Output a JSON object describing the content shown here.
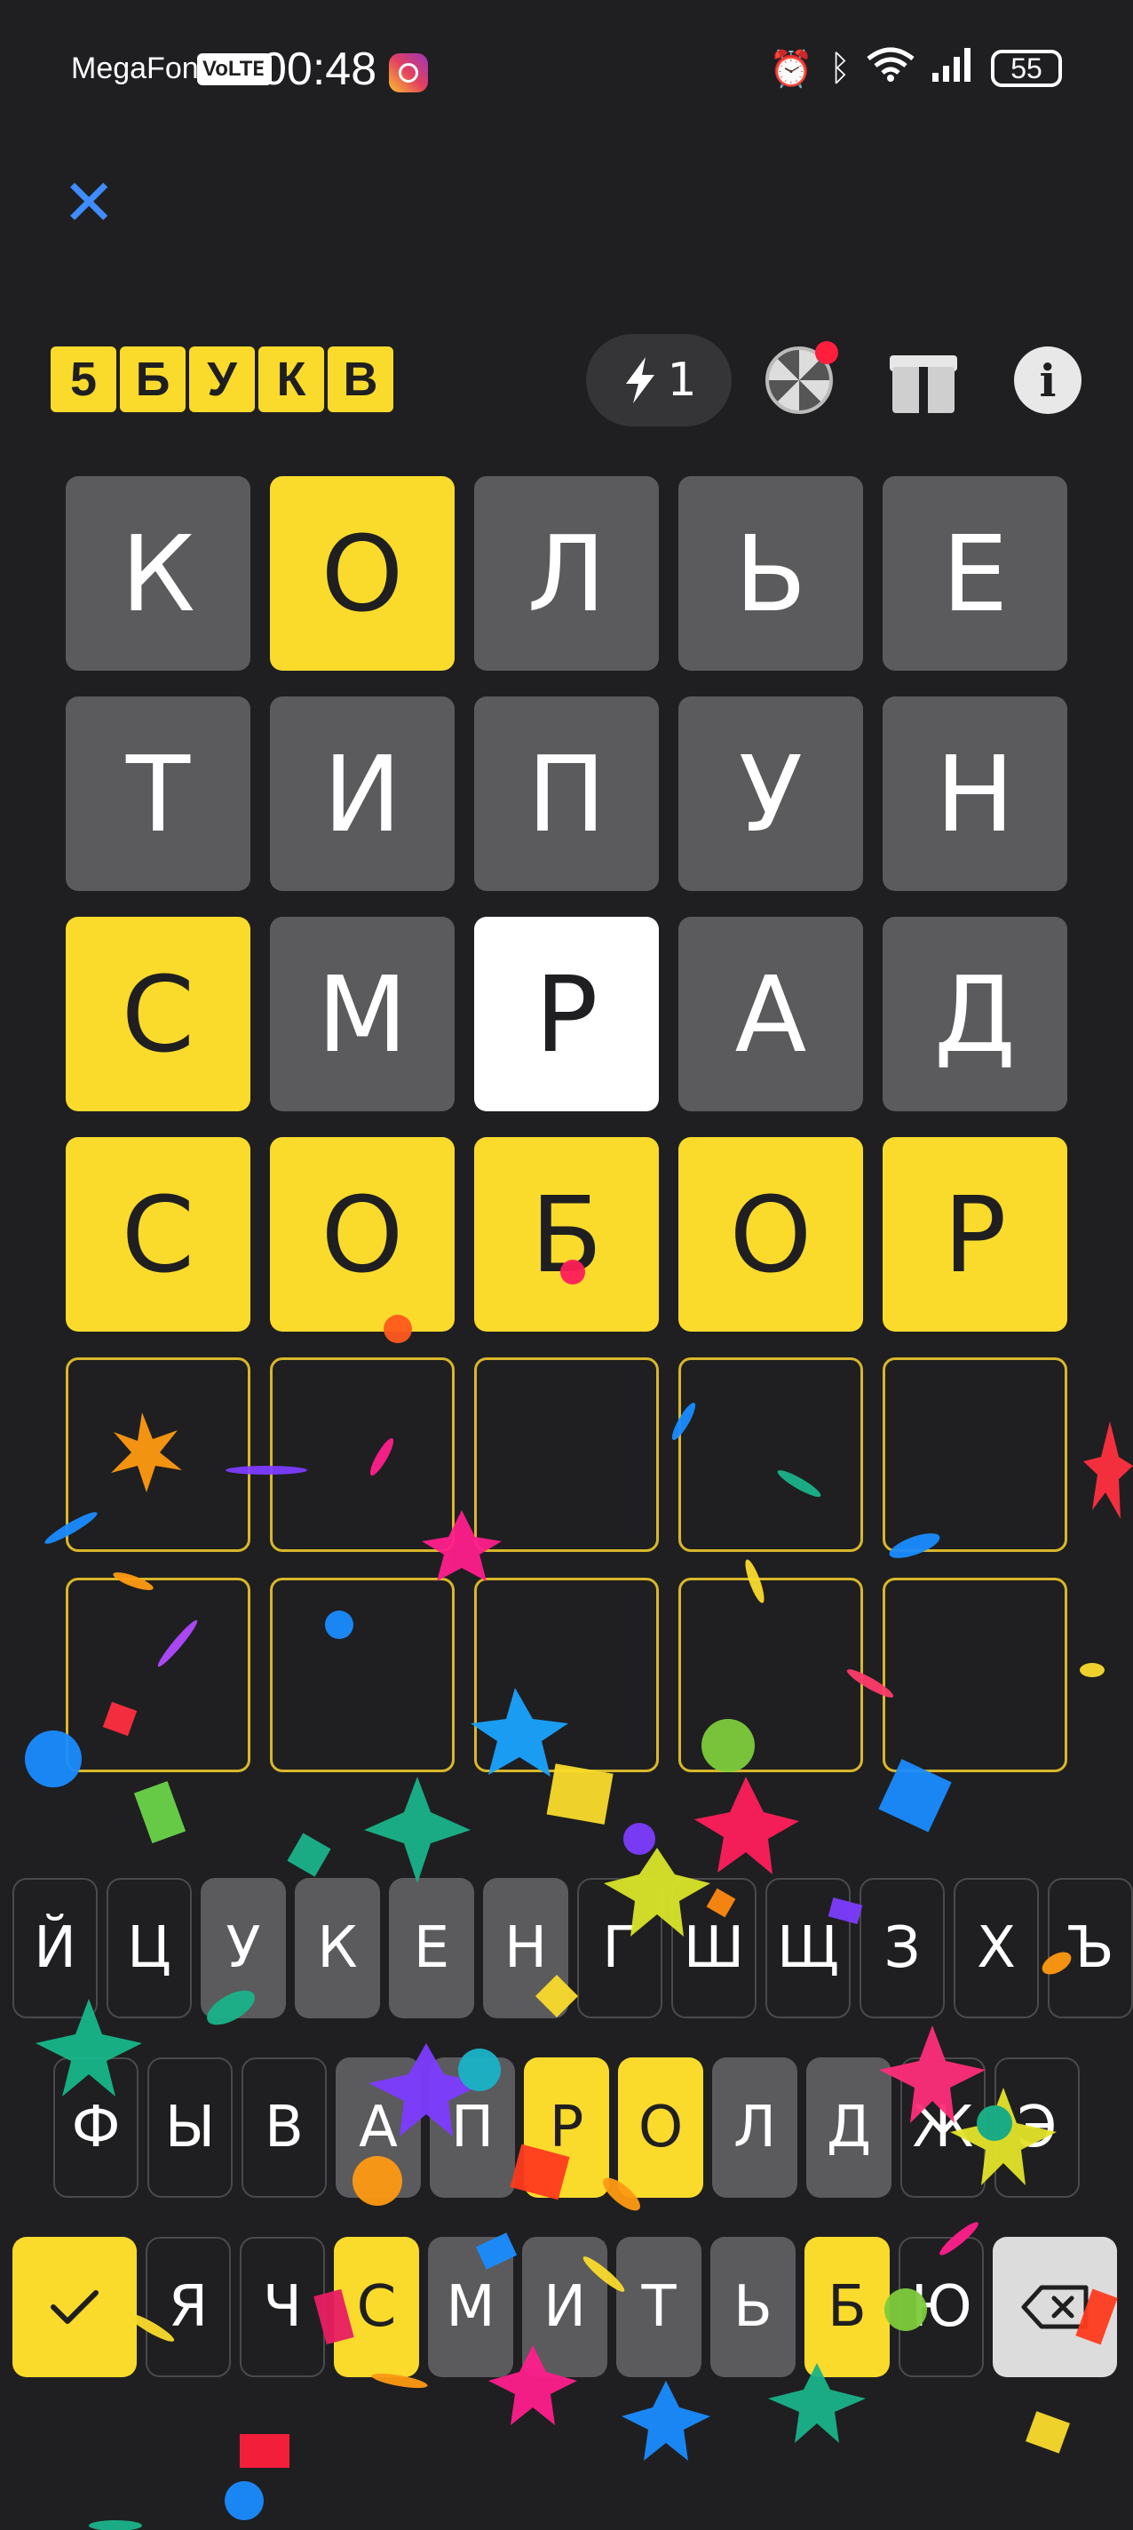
{
  "status_bar": {
    "carrier": "MegaFon",
    "volte": "VoLTE",
    "time": "00:48",
    "battery": "55"
  },
  "header": {
    "logo_letters": [
      "5",
      "Б",
      "У",
      "К",
      "В"
    ],
    "energy_count": "1"
  },
  "board": {
    "rows": [
      [
        {
          "l": "К",
          "s": "gray"
        },
        {
          "l": "О",
          "s": "yellow"
        },
        {
          "l": "Л",
          "s": "gray"
        },
        {
          "l": "Ь",
          "s": "gray"
        },
        {
          "l": "Е",
          "s": "gray"
        }
      ],
      [
        {
          "l": "Т",
          "s": "gray"
        },
        {
          "l": "И",
          "s": "gray"
        },
        {
          "l": "П",
          "s": "gray"
        },
        {
          "l": "У",
          "s": "gray"
        },
        {
          "l": "Н",
          "s": "gray"
        }
      ],
      [
        {
          "l": "С",
          "s": "yellow"
        },
        {
          "l": "М",
          "s": "gray"
        },
        {
          "l": "Р",
          "s": "white"
        },
        {
          "l": "А",
          "s": "gray"
        },
        {
          "l": "Д",
          "s": "gray"
        }
      ],
      [
        {
          "l": "С",
          "s": "yellow"
        },
        {
          "l": "О",
          "s": "yellow"
        },
        {
          "l": "Б",
          "s": "yellow"
        },
        {
          "l": "О",
          "s": "yellow"
        },
        {
          "l": "Р",
          "s": "yellow"
        }
      ],
      [
        {
          "l": "",
          "s": "empty"
        },
        {
          "l": "",
          "s": "empty"
        },
        {
          "l": "",
          "s": "empty"
        },
        {
          "l": "",
          "s": "empty"
        },
        {
          "l": "",
          "s": "empty"
        }
      ],
      [
        {
          "l": "",
          "s": "empty"
        },
        {
          "l": "",
          "s": "empty"
        },
        {
          "l": "",
          "s": "empty"
        },
        {
          "l": "",
          "s": "empty"
        },
        {
          "l": "",
          "s": "empty"
        }
      ]
    ]
  },
  "keyboard": {
    "row1": [
      {
        "k": "Й",
        "s": "def"
      },
      {
        "k": "Ц",
        "s": "def"
      },
      {
        "k": "У",
        "s": "gray"
      },
      {
        "k": "К",
        "s": "gray"
      },
      {
        "k": "Е",
        "s": "gray"
      },
      {
        "k": "Н",
        "s": "gray"
      },
      {
        "k": "Г",
        "s": "def"
      },
      {
        "k": "Ш",
        "s": "def"
      },
      {
        "k": "Щ",
        "s": "def"
      },
      {
        "k": "З",
        "s": "def"
      },
      {
        "k": "Х",
        "s": "def"
      },
      {
        "k": "Ъ",
        "s": "def"
      }
    ],
    "row2": [
      {
        "k": "Ф",
        "s": "def"
      },
      {
        "k": "Ы",
        "s": "def"
      },
      {
        "k": "В",
        "s": "def"
      },
      {
        "k": "А",
        "s": "gray"
      },
      {
        "k": "П",
        "s": "gray"
      },
      {
        "k": "Р",
        "s": "yellow"
      },
      {
        "k": "О",
        "s": "yellow"
      },
      {
        "k": "Л",
        "s": "gray"
      },
      {
        "k": "Д",
        "s": "gray"
      },
      {
        "k": "Ж",
        "s": "def"
      },
      {
        "k": "Э",
        "s": "def"
      }
    ],
    "row3": [
      {
        "k": "Я",
        "s": "def"
      },
      {
        "k": "Ч",
        "s": "def"
      },
      {
        "k": "С",
        "s": "yellow"
      },
      {
        "k": "М",
        "s": "gray"
      },
      {
        "k": "И",
        "s": "gray"
      },
      {
        "k": "Т",
        "s": "gray"
      },
      {
        "k": "Ь",
        "s": "gray"
      },
      {
        "k": "Б",
        "s": "yellow"
      },
      {
        "k": "Ю",
        "s": "def"
      }
    ],
    "enter_icon": "check-icon",
    "backspace_icon": "backspace-icon"
  },
  "colors": {
    "background": "#1f1f21",
    "tile_gray": "#5b5b5d",
    "accent_yellow": "#fadb2c",
    "close_blue": "#3f8cff"
  }
}
